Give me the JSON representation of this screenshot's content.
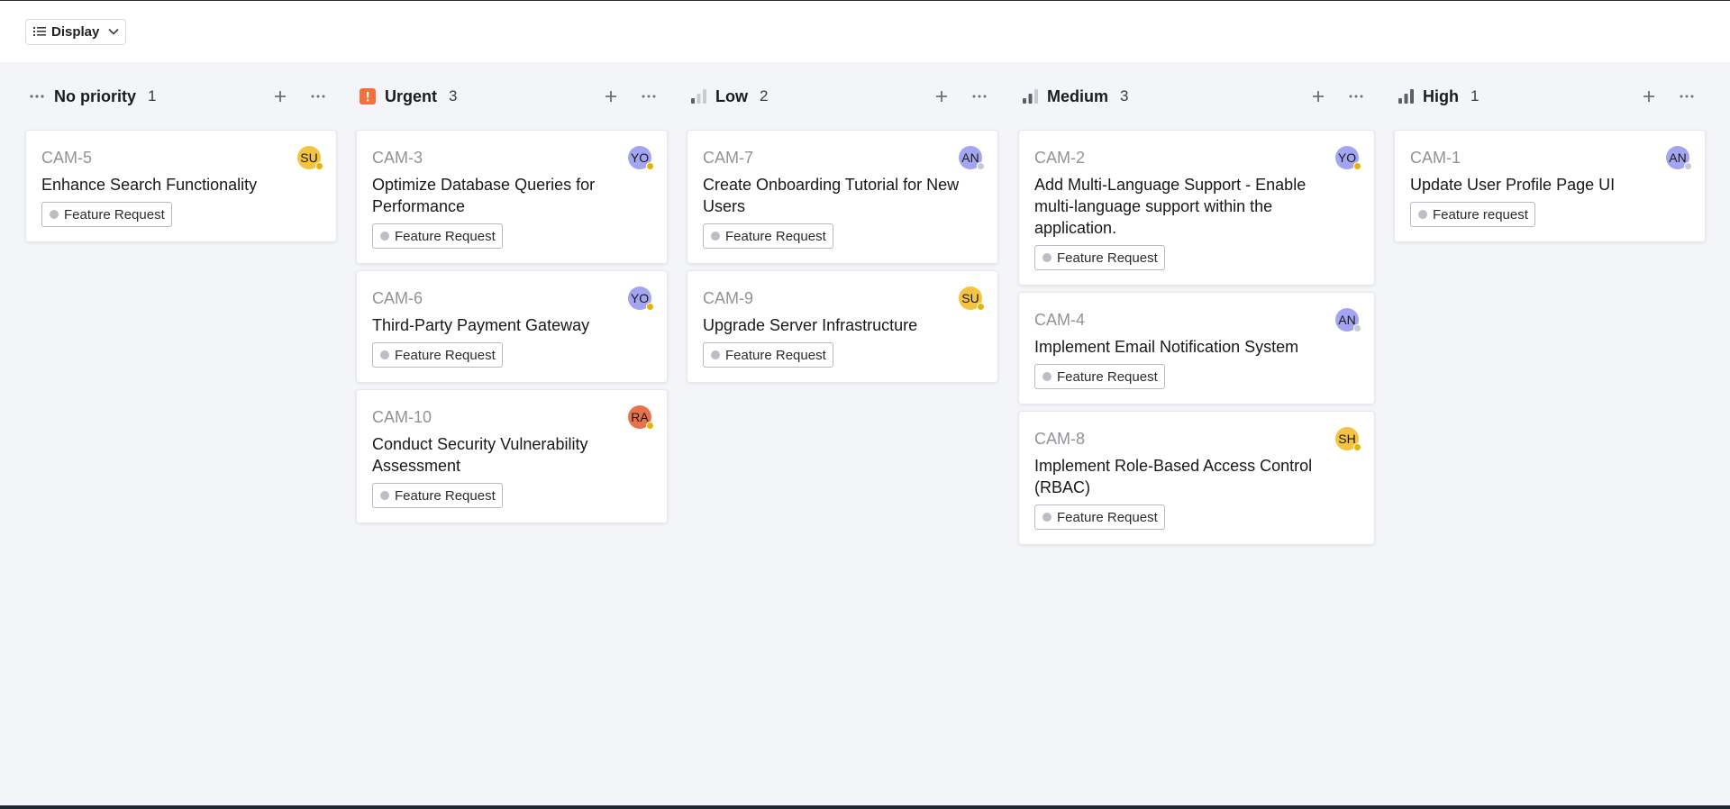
{
  "toolbar": {
    "display_label": "Display"
  },
  "colors": {
    "avatar_yellow": "#f5c342",
    "avatar_purple": "#a4a5f0",
    "avatar_orange": "#e8734a",
    "status_away": "#e9b400",
    "status_offline": "#c8cad0",
    "urgent_orange": "#f2703a"
  },
  "columns": [
    {
      "title": "No priority",
      "count": "1",
      "icon": "dots-icon",
      "cards": [
        {
          "id": "CAM-5",
          "title": "Enhance Search Functionality",
          "label": "Feature Request",
          "avatar": "SU",
          "avatar_color": "#f5c342",
          "status": "away"
        }
      ]
    },
    {
      "title": "Urgent",
      "count": "3",
      "icon": "urgent-icon",
      "cards": [
        {
          "id": "CAM-3",
          "title": "Optimize Database Queries for Performance",
          "label": "Feature Request",
          "avatar": "YO",
          "avatar_color": "#a4a5f0",
          "status": "away"
        },
        {
          "id": "CAM-6",
          "title": "Third-Party Payment Gateway",
          "label": "Feature Request",
          "avatar": "YO",
          "avatar_color": "#a4a5f0",
          "status": "away"
        },
        {
          "id": "CAM-10",
          "title": "Conduct Security Vulnerability Assessment",
          "label": "Feature Request",
          "avatar": "RA",
          "avatar_color": "#e8734a",
          "status": "away"
        }
      ]
    },
    {
      "title": "Low",
      "count": "2",
      "icon": "bars-low-icon",
      "cards": [
        {
          "id": "CAM-7",
          "title": "Create Onboarding Tutorial for New Users",
          "label": "Feature Request",
          "avatar": "AN",
          "avatar_color": "#a4a5f0",
          "status": "offline"
        },
        {
          "id": "CAM-9",
          "title": "Upgrade Server Infrastructure",
          "label": "Feature Request",
          "avatar": "SU",
          "avatar_color": "#f5c342",
          "status": "away"
        }
      ]
    },
    {
      "title": "Medium",
      "count": "3",
      "icon": "bars-medium-icon",
      "cards": [
        {
          "id": "CAM-2",
          "title": "Add Multi-Language Support - Enable multi-language support within the application.",
          "label": "Feature Request",
          "avatar": "YO",
          "avatar_color": "#a4a5f0",
          "status": "away"
        },
        {
          "id": "CAM-4",
          "title": "Implement Email Notification System",
          "label": "Feature Request",
          "avatar": "AN",
          "avatar_color": "#a4a5f0",
          "status": "offline"
        },
        {
          "id": "CAM-8",
          "title": "Implement Role-Based Access Control (RBAC)",
          "label": "Feature Request",
          "avatar": "SH",
          "avatar_color": "#f5c342",
          "status": "away"
        }
      ]
    },
    {
      "title": "High",
      "count": "1",
      "icon": "bars-high-icon",
      "cards": [
        {
          "id": "CAM-1",
          "title": "Update User Profile Page UI",
          "label": "Feature request",
          "avatar": "AN",
          "avatar_color": "#a4a5f0",
          "status": "offline"
        }
      ]
    }
  ]
}
